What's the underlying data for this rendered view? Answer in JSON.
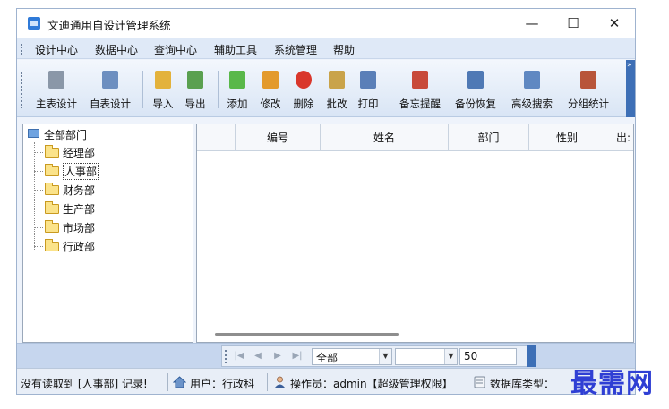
{
  "window": {
    "title": "文迪通用自设计管理系统",
    "controls": {
      "minimize": "—",
      "maximize": "☐",
      "close": "✕"
    }
  },
  "menubar": {
    "items": [
      "设计中心",
      "数据中心",
      "查询中心",
      "辅助工具",
      "系统管理",
      "帮助"
    ]
  },
  "toolbar": {
    "buttons": [
      {
        "label": "主表设计",
        "icon": "table-icon",
        "color": "#8a97a8"
      },
      {
        "label": "自表设计",
        "icon": "calendar-table-icon",
        "color": "#6d8fc0"
      },
      {
        "label": "导入",
        "icon": "import-folder-icon",
        "color": "#e3b23c"
      },
      {
        "label": "导出",
        "icon": "export-document-icon",
        "color": "#5aa050"
      },
      {
        "label": "添加",
        "icon": "add-document-icon",
        "color": "#59b84a"
      },
      {
        "label": "修改",
        "icon": "pencil-icon",
        "color": "#e39a2d"
      },
      {
        "label": "删除",
        "icon": "delete-icon",
        "color": "#d9372c"
      },
      {
        "label": "批改",
        "icon": "batch-edit-icon",
        "color": "#c9a34a"
      },
      {
        "label": "打印",
        "icon": "printer-icon",
        "color": "#5a7fb8"
      },
      {
        "label": "备忘提醒",
        "icon": "calendar-31-icon",
        "color": "#c84a3a"
      },
      {
        "label": "备份恢复",
        "icon": "floppy-disk-icon",
        "color": "#4f79b5"
      },
      {
        "label": "高级搜索",
        "icon": "search-window-icon",
        "color": "#5f88c2"
      },
      {
        "label": "分组统计",
        "icon": "books-chart-icon",
        "color": "#b8553a"
      }
    ]
  },
  "tree": {
    "root": "全部部门",
    "nodes": [
      "经理部",
      "人事部",
      "财务部",
      "生产部",
      "市场部",
      "行政部"
    ],
    "selected": "人事部"
  },
  "grid": {
    "columns": [
      "",
      "编号",
      "姓名",
      "部门",
      "性别",
      "出:"
    ],
    "rows": []
  },
  "navigator": {
    "buttons": [
      "|◀",
      "◀",
      "▶",
      "▶|"
    ],
    "filter_value": "全部",
    "second_filter_value": "",
    "page_size": "50"
  },
  "status": {
    "message": "没有读取到 [人事部] 记录!",
    "user": "用户：行政科",
    "operator": "操作员：admin【超级管理权限】",
    "db_type": "数据库类型：",
    "accent": "#3d6fb6"
  },
  "watermark": "最需网"
}
